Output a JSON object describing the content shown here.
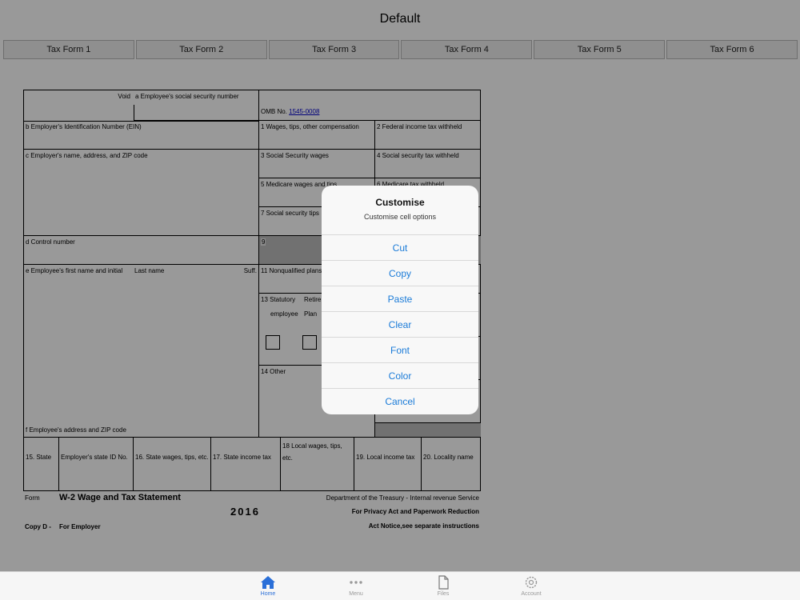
{
  "nav": {
    "title": "Default"
  },
  "tabs": [
    "Tax Form 1",
    "Tax Form 2",
    "Tax Form 3",
    "Tax Form 4",
    "Tax Form 5",
    "Tax Form 6"
  ],
  "form": {
    "void": "Void",
    "a": "a Employee's social security number",
    "omb_prefix": "OMB No.",
    "omb_number": "1545-0008",
    "b": "b Employer's Identification Number (EIN)",
    "box1": "1  Wages, tips, other compensation",
    "box2": "2 Federal income tax withheld",
    "c": "c Employer's name, address, and ZIP code",
    "box3": "3  Social Security wages",
    "box4": "4 Social security tax withheld",
    "box5": "5  Medicare wages and tips",
    "box6": "6 Medicare tax withheld",
    "box7": "7  Social security tips",
    "d": "d Control number",
    "box9": "9",
    "e": "e Employee's first name and initial",
    "last_name": "Last name",
    "suff": "Suff.",
    "box11": "11 Nonqualified plans",
    "box13": "13 Statutory",
    "retire": "Retire",
    "employee": "employee",
    "plan": "Plan",
    "box14": "14 Other",
    "f": "f Employee's address and ZIP code",
    "box15": "15. State",
    "state_id": "Employer's state ID No.",
    "box16": "16. State wages, tips, etc.",
    "box17": "17. State income tax",
    "box18": "18 Local wages, tips, etc.",
    "box19": "19. Local income tax",
    "box20": "20. Locality name",
    "form_label": "Form",
    "form_title": "W-2 Wage and Tax Statement",
    "year": "2016",
    "dept": "Department of the Treasury - Internal revenue Service",
    "privacy1": "For Privacy Act and Paperwork Reduction",
    "privacy2": "Act Notice,see separate instructions",
    "copy": "Copy D -",
    "copy_for": "For Employer"
  },
  "sheet": {
    "title": "Customise",
    "subtitle": "Customise cell options",
    "items": [
      "Cut",
      "Copy",
      "Paste",
      "Clear",
      "Font",
      "Color",
      "Cancel"
    ]
  },
  "tabbar": {
    "items": [
      {
        "label": "Home",
        "icon": "home-icon"
      },
      {
        "label": "Menu",
        "icon": "more-icon"
      },
      {
        "label": "Files",
        "icon": "file-icon"
      },
      {
        "label": "Account",
        "icon": "gear-icon"
      }
    ]
  },
  "colors": {
    "accent": "#1a7bd8",
    "tab_active": "#2a6fd8",
    "overlay": "rgba(0,0,0,0.40)"
  }
}
